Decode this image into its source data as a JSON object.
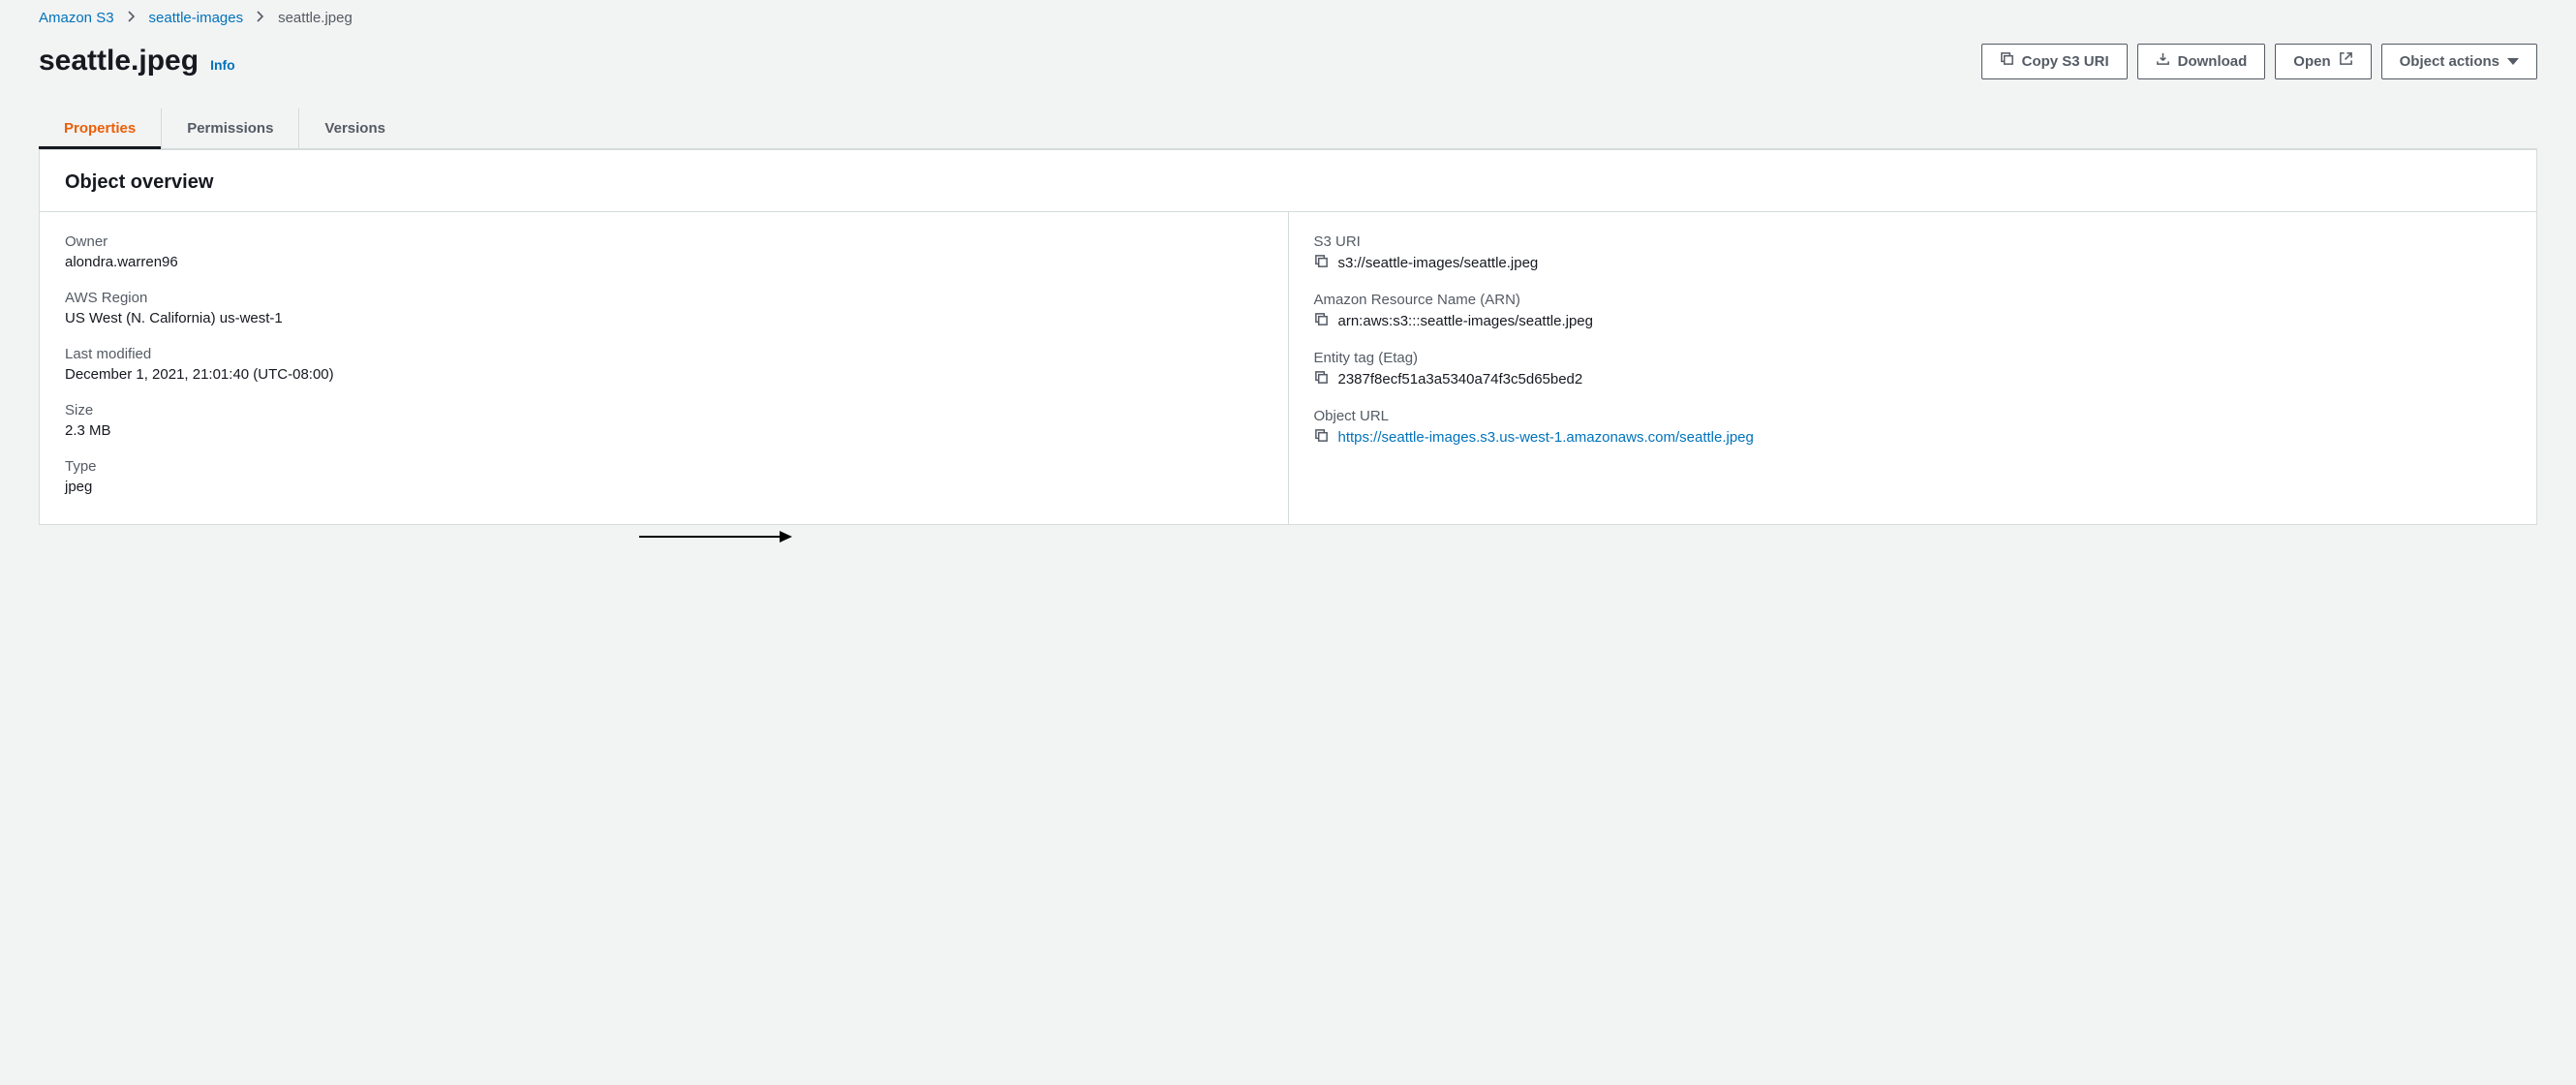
{
  "breadcrumb": {
    "root": "Amazon S3",
    "bucket": "seattle-images",
    "object": "seattle.jpeg"
  },
  "header": {
    "title": "seattle.jpeg",
    "info": "Info"
  },
  "actions": {
    "copy_s3_uri": "Copy S3 URI",
    "download": "Download",
    "open": "Open",
    "object_actions": "Object actions"
  },
  "tabs": {
    "properties": "Properties",
    "permissions": "Permissions",
    "versions": "Versions"
  },
  "overview": {
    "heading": "Object overview",
    "left": {
      "owner_label": "Owner",
      "owner_value": "alondra.warren96",
      "region_label": "AWS Region",
      "region_value": "US West (N. California) us-west-1",
      "modified_label": "Last modified",
      "modified_value": "December 1, 2021, 21:01:40 (UTC-08:00)",
      "size_label": "Size",
      "size_value": "2.3 MB",
      "type_label": "Type",
      "type_value": "jpeg"
    },
    "right": {
      "s3uri_label": "S3 URI",
      "s3uri_value": "s3://seattle-images/seattle.jpeg",
      "arn_label": "Amazon Resource Name (ARN)",
      "arn_value": "arn:aws:s3:::seattle-images/seattle.jpeg",
      "etag_label": "Entity tag (Etag)",
      "etag_value": "2387f8ecf51a3a5340a74f3c5d65bed2",
      "url_label": "Object URL",
      "url_value": "https://seattle-images.s3.us-west-1.amazonaws.com/seattle.jpeg"
    }
  }
}
